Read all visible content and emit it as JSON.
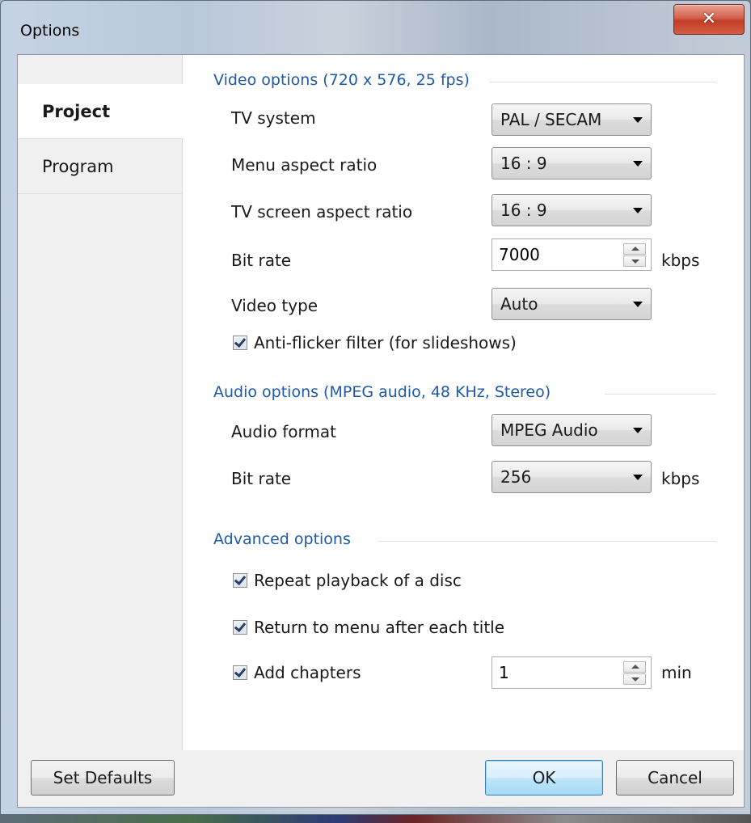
{
  "window": {
    "title": "Options"
  },
  "tabs": [
    {
      "label": "Project",
      "active": true
    },
    {
      "label": "Program",
      "active": false
    }
  ],
  "video": {
    "heading": "Video options (720 x 576, 25 fps)",
    "tv_system": {
      "label": "TV system",
      "value": "PAL / SECAM"
    },
    "menu_aspect": {
      "label": "Menu aspect ratio",
      "value": "16 : 9"
    },
    "tv_aspect": {
      "label": "TV screen aspect ratio",
      "value": "16 : 9"
    },
    "bitrate": {
      "label": "Bit rate",
      "value": "7000",
      "unit": "kbps"
    },
    "video_type": {
      "label": "Video type",
      "value": "Auto"
    },
    "antiflicker": {
      "label": "Anti-flicker filter (for slideshows)",
      "checked": true
    }
  },
  "audio": {
    "heading": "Audio options (MPEG audio, 48 KHz, Stereo)",
    "format": {
      "label": "Audio format",
      "value": "MPEG Audio"
    },
    "bitrate": {
      "label": "Bit rate",
      "value": "256",
      "unit": "kbps"
    }
  },
  "advanced": {
    "heading": "Advanced options",
    "repeat": {
      "label": "Repeat playback of a disc",
      "checked": true
    },
    "return_menu": {
      "label": "Return to menu after each title",
      "checked": true
    },
    "chapters": {
      "label": "Add chapters",
      "checked": true,
      "value": "1",
      "unit": "min"
    }
  },
  "footer": {
    "set_defaults": "Set Defaults",
    "ok": "OK",
    "cancel": "Cancel"
  },
  "icons": {
    "close": "close-icon"
  }
}
